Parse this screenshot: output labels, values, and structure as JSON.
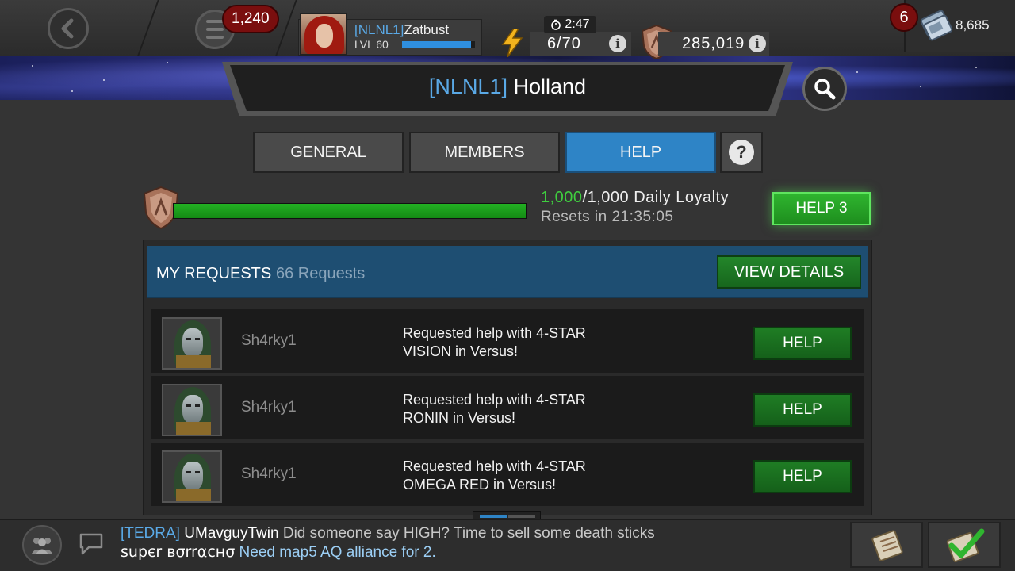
{
  "topbar": {
    "menu_badge": "1,240",
    "player_tag": "[NLNL1]",
    "player_name": "Zatbust",
    "player_level": "LVL 60",
    "xp_progress": 0.95,
    "energy_timer": "2:47",
    "energy": "6/70",
    "loyalty_total": "285,019",
    "units_badge": "6",
    "units": "8,685"
  },
  "alliance": {
    "tag": "[NLNL1]",
    "name": "Holland"
  },
  "tabs": [
    {
      "label": "GENERAL",
      "active": false
    },
    {
      "label": "MEMBERS",
      "active": false
    },
    {
      "label": "HELP",
      "active": true
    }
  ],
  "loyalty": {
    "current": "1,000",
    "max_label": "/1,000 Daily Loyalty",
    "progress": 1.0,
    "resets": "Resets in 21:35:05",
    "help_button": "HELP 3"
  },
  "requests": {
    "title": "MY REQUESTS",
    "count": "66 Requests",
    "view_details": "VIEW DETAILS",
    "rows": [
      {
        "user": "Sh4rky1",
        "message": "Requested help with 4-STAR VISION in Versus!",
        "button": "HELP"
      },
      {
        "user": "Sh4rky1",
        "message": "Requested help with 4-STAR RONIN in Versus!",
        "button": "HELP"
      },
      {
        "user": "Sh4rky1",
        "message": "Requested help with 4-STAR OMEGA RED in Versus!",
        "button": "HELP"
      }
    ]
  },
  "chat": [
    {
      "tag": "[TEDRA]",
      "user": "UMavguyTwin",
      "message": "Did someone say HIGH? Time to sell some death sticks"
    },
    {
      "tag": "",
      "user": "supєr вσrrαcнσ",
      "message": "Need map5 AQ alliance for 2."
    }
  ],
  "colors": {
    "accent_blue": "#2e84c6",
    "tag_blue": "#5aa9e6",
    "help_green": "#1f7d24",
    "progress_green": "#23b123",
    "badge_red": "#7a0e0e"
  },
  "icons": [
    "back-icon",
    "menu-icon",
    "energy-icon",
    "timer-icon",
    "info-icon",
    "loyalty-shield-icon",
    "units-icon",
    "search-icon",
    "question-icon",
    "alliance-members-icon",
    "chat-bubble-icon",
    "quests-icon",
    "checkmark-icon"
  ]
}
